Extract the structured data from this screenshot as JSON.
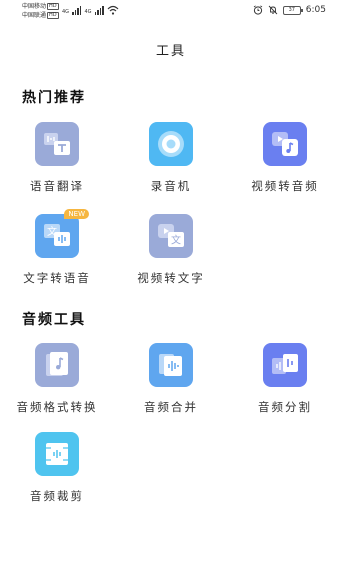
{
  "status_bar": {
    "carrier1": "中国移动",
    "carrier2": "中国联通",
    "hd": "HD",
    "net1": "4G",
    "net2": "4G",
    "battery": "37",
    "time": "6:05"
  },
  "header": {
    "title": "工具"
  },
  "sections": [
    {
      "title": "热门推荐",
      "tools": [
        {
          "label": "语音翻译",
          "icon": "voice-translate-icon",
          "color": "#9aaad8"
        },
        {
          "label": "录音机",
          "icon": "recorder-icon",
          "color": "#4fb8f3"
        },
        {
          "label": "视频转音频",
          "icon": "video-to-audio-icon",
          "color": "#6a7ff0"
        },
        {
          "label": "文字转语音",
          "icon": "text-to-speech-icon",
          "color": "#5fa6ef",
          "badge": "NEW"
        },
        {
          "label": "视频转文字",
          "icon": "video-to-text-icon",
          "color": "#9aaad8"
        }
      ]
    },
    {
      "title": "音频工具",
      "tools": [
        {
          "label": "音频格式转换",
          "icon": "audio-format-convert-icon",
          "color": "#9aaad8"
        },
        {
          "label": "音频合并",
          "icon": "audio-merge-icon",
          "color": "#5fa6ef"
        },
        {
          "label": "音频分割",
          "icon": "audio-split-icon",
          "color": "#6a7ff0"
        },
        {
          "label": "音频裁剪",
          "icon": "audio-trim-icon",
          "color": "#4fc4ef"
        }
      ]
    }
  ]
}
